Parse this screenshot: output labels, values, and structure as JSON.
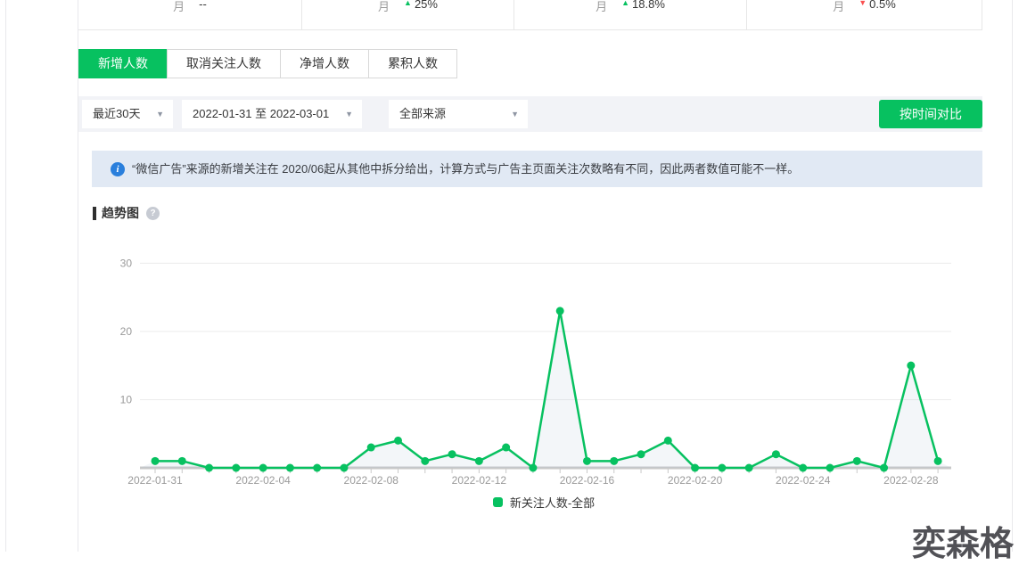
{
  "stats_row": [
    {
      "label": "月",
      "value": "--",
      "trend": null
    },
    {
      "label": "月",
      "value": "25%",
      "trend": "up"
    },
    {
      "label": "月",
      "value": "18.8%",
      "trend": "up"
    },
    {
      "label": "月",
      "value": "0.5%",
      "trend": "down"
    }
  ],
  "tabs": [
    {
      "label": "新增人数",
      "active": true
    },
    {
      "label": "取消关注人数",
      "active": false
    },
    {
      "label": "净增人数",
      "active": false
    },
    {
      "label": "累积人数",
      "active": false
    }
  ],
  "filters": {
    "time_range": "最近30天",
    "date_range": "2022-01-31 至 2022-03-01",
    "source": "全部来源",
    "compare_button": "按时间对比",
    "caret": "▼"
  },
  "notice": {
    "icon": "i",
    "text": "“微信广告”来源的新增关注在 2020/06起从其他中拆分给出，计算方式与广告主页面关注次数略有不同，因此两者数值可能不一样。"
  },
  "section": {
    "title": "趋势图",
    "help": "?"
  },
  "watermark": "奕森格",
  "colors": {
    "green": "#07c160",
    "red": "#fa5151",
    "banner_bg": "#e1e9f4",
    "filter_bg": "#f2f3f7",
    "grid": "#ececec",
    "axis": "#c9c9c9",
    "tick_label": "#9a9a9a",
    "area_fill": "rgba(160,185,205,0.13)"
  },
  "chart_data": {
    "type": "line",
    "title": "趋势图",
    "x": [
      "2022-01-31",
      "2022-02-01",
      "2022-02-02",
      "2022-02-03",
      "2022-02-04",
      "2022-02-05",
      "2022-02-06",
      "2022-02-07",
      "2022-02-08",
      "2022-02-09",
      "2022-02-10",
      "2022-02-11",
      "2022-02-12",
      "2022-02-13",
      "2022-02-14",
      "2022-02-15",
      "2022-02-16",
      "2022-02-17",
      "2022-02-18",
      "2022-02-19",
      "2022-02-20",
      "2022-02-21",
      "2022-02-22",
      "2022-02-23",
      "2022-02-24",
      "2022-02-25",
      "2022-02-26",
      "2022-02-27",
      "2022-02-28",
      "2022-03-01"
    ],
    "series": [
      {
        "name": "新关注人数-全部",
        "values": [
          1,
          1,
          0,
          0,
          0,
          0,
          0,
          0,
          3,
          4,
          1,
          2,
          1,
          3,
          0,
          23,
          1,
          1,
          2,
          4,
          0,
          0,
          0,
          2,
          0,
          0,
          1,
          0,
          15,
          1
        ]
      }
    ],
    "ylim": [
      0,
      30
    ],
    "yticks": [
      10,
      20,
      30
    ],
    "x_label_interval": 4,
    "grid": true,
    "legend": [
      "新关注人数-全部"
    ],
    "legend_position": "bottom"
  }
}
